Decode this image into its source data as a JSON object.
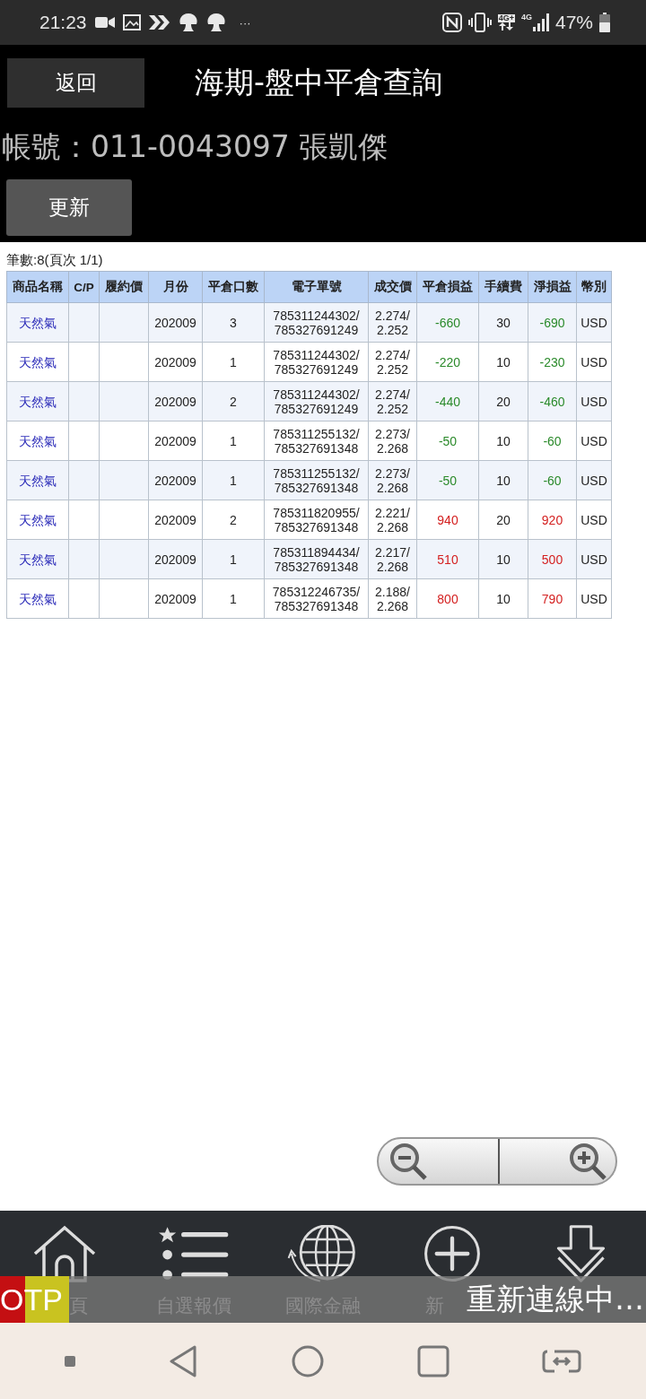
{
  "status_bar": {
    "time": "21:23",
    "more": "···",
    "network": "4G+",
    "signal_label": "4G",
    "battery": "47%"
  },
  "header": {
    "back_button": "返回",
    "title": "海期-盤中平倉查詢",
    "account": "帳號：011-0043097 張凱傑",
    "refresh_button": "更新"
  },
  "record_count": "筆數:8(頁次 1/1)",
  "table": {
    "columns": [
      "商品名稱",
      "C/P",
      "履約價",
      "月份",
      "平倉口數",
      "電子單號",
      "成交價",
      "平倉損益",
      "手續費",
      "淨損益",
      "幣別"
    ],
    "rows": [
      {
        "product": "天然氣",
        "month": "202009",
        "lots": "3",
        "order_no": [
          "785311244302/",
          "785327691249"
        ],
        "price": [
          "2.274/",
          "2.252"
        ],
        "pnl": "-660",
        "fee": "30",
        "net": "-690",
        "currency": "USD",
        "color": "#2a8a2a"
      },
      {
        "product": "天然氣",
        "month": "202009",
        "lots": "1",
        "order_no": [
          "785311244302/",
          "785327691249"
        ],
        "price": [
          "2.274/",
          "2.252"
        ],
        "pnl": "-220",
        "fee": "10",
        "net": "-230",
        "currency": "USD",
        "color": "#2a8a2a"
      },
      {
        "product": "天然氣",
        "month": "202009",
        "lots": "2",
        "order_no": [
          "785311244302/",
          "785327691249"
        ],
        "price": [
          "2.274/",
          "2.252"
        ],
        "pnl": "-440",
        "fee": "20",
        "net": "-460",
        "currency": "USD",
        "color": "#2a8a2a"
      },
      {
        "product": "天然氣",
        "month": "202009",
        "lots": "1",
        "order_no": [
          "785311255132/",
          "785327691348"
        ],
        "price": [
          "2.273/",
          "2.268"
        ],
        "pnl": "-50",
        "fee": "10",
        "net": "-60",
        "currency": "USD",
        "color": "#2a8a2a"
      },
      {
        "product": "天然氣",
        "month": "202009",
        "lots": "1",
        "order_no": [
          "785311255132/",
          "785327691348"
        ],
        "price": [
          "2.273/",
          "2.268"
        ],
        "pnl": "-50",
        "fee": "10",
        "net": "-60",
        "currency": "USD",
        "color": "#2a8a2a"
      },
      {
        "product": "天然氣",
        "month": "202009",
        "lots": "2",
        "order_no": [
          "785311820955/",
          "785327691348"
        ],
        "price": [
          "2.221/",
          "2.268"
        ],
        "pnl": "940",
        "fee": "20",
        "net": "920",
        "currency": "USD",
        "color": "#d42020"
      },
      {
        "product": "天然氣",
        "month": "202009",
        "lots": "1",
        "order_no": [
          "785311894434/",
          "785327691348"
        ],
        "price": [
          "2.217/",
          "2.268"
        ],
        "pnl": "510",
        "fee": "10",
        "net": "500",
        "currency": "USD",
        "color": "#d42020"
      },
      {
        "product": "天然氣",
        "month": "202009",
        "lots": "1",
        "order_no": [
          "785312246735/",
          "785327691348"
        ],
        "price": [
          "2.188/",
          "2.268"
        ],
        "pnl": "800",
        "fee": "10",
        "net": "790",
        "currency": "USD",
        "color": "#d42020"
      }
    ]
  },
  "bottom_nav": {
    "items": [
      {
        "kind": "home",
        "label": "頁"
      },
      {
        "kind": "list",
        "label": "自選報價"
      },
      {
        "kind": "globe",
        "label": "國際金融"
      },
      {
        "kind": "add",
        "label": "新"
      },
      {
        "kind": "download"
      }
    ]
  },
  "otp_badge": "OTP",
  "toast": "重新連線中…"
}
